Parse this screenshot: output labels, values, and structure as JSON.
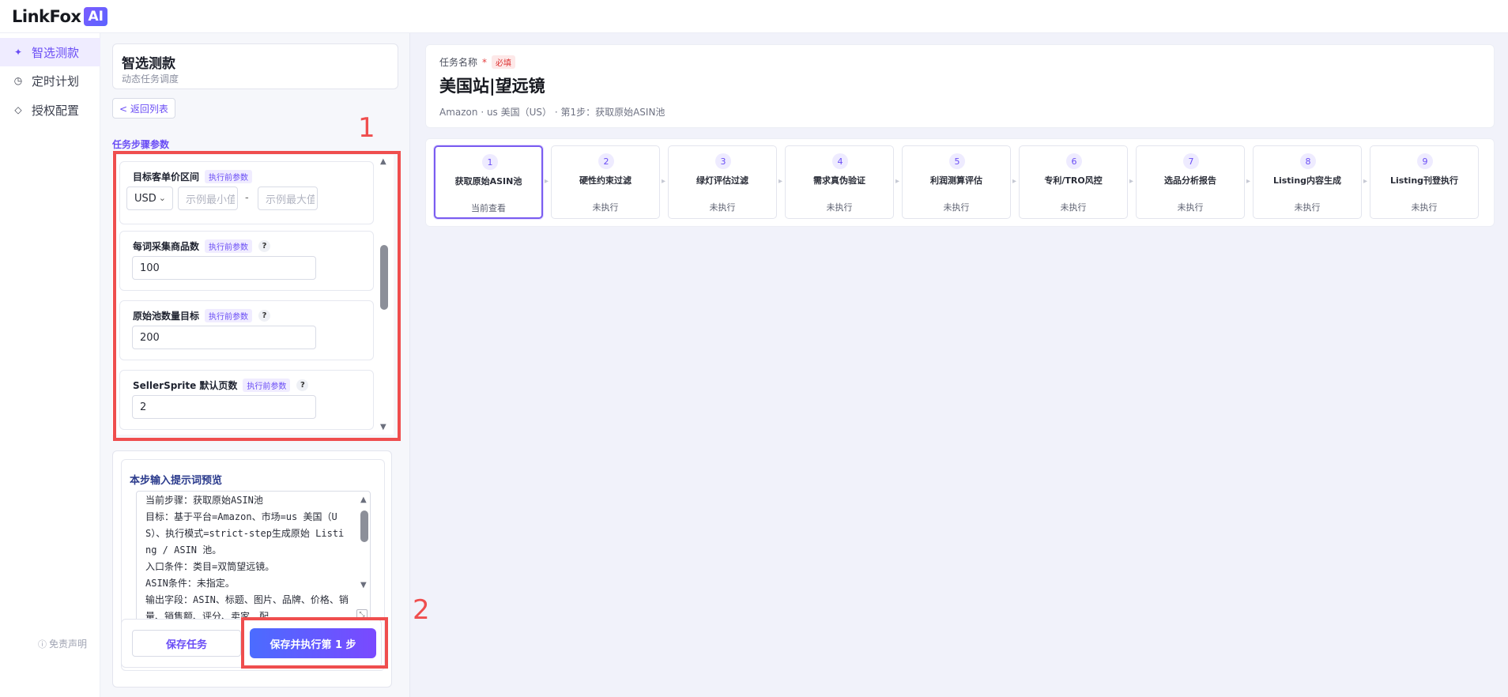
{
  "app": {
    "logo_text": "LinkFox",
    "logo_badge": "AI"
  },
  "nav": {
    "items": [
      {
        "label": "智选测款",
        "icon": "sparkle-icon"
      },
      {
        "label": "定时计划",
        "icon": "clock-icon"
      },
      {
        "label": "授权配置",
        "icon": "diamond-icon"
      }
    ],
    "disclaimer": "免责声明"
  },
  "left": {
    "title": "智选测款",
    "subtitle": "动态任务调度",
    "back_label": "< 返回列表",
    "section_label": "任务步骤参数",
    "params": {
      "price": {
        "title": "目标客单价区间",
        "chip": "执行前参数",
        "currency": "USD",
        "min_placeholder": "示例最小值",
        "max_placeholder": "示例最大值",
        "dash": "-"
      },
      "per_word": {
        "title": "每词采集商品数",
        "chip": "执行前参数",
        "value": "100"
      },
      "pool": {
        "title": "原始池数量目标",
        "chip": "执行前参数",
        "value": "200"
      },
      "pages": {
        "title": "SellerSprite 默认页数",
        "chip": "执行前参数",
        "value": "2"
      }
    },
    "prompt": {
      "title": "本步输入提示词预览",
      "text": "当前步骤：获取原始ASIN池\n目标：基于平台=Amazon、市场=us 美国（US）、执行模式=strict-step生成原始 Listing / ASIN 池。\n入口条件：类目=双筒望远镜。\nASIN条件：未指定。\n输出字段：ASIN、标题、图片、品牌、价格、销量、销售额、评分、卖家、配"
    },
    "save_label": "保存任务",
    "run_label": "保存并执行第 1 步"
  },
  "annotations": {
    "one": "1",
    "two": "2"
  },
  "task": {
    "label": "任务名称",
    "required_star": "*",
    "required_chip": "必填",
    "name": "美国站|望远镜",
    "meta": "Amazon · us 美国（US） · 第1步：获取原始ASIN池"
  },
  "steps": [
    {
      "num": "1",
      "name": "获取原始ASIN池",
      "status": "当前查看"
    },
    {
      "num": "2",
      "name": "硬性约束过滤",
      "status": "未执行"
    },
    {
      "num": "3",
      "name": "绿灯评估过滤",
      "status": "未执行"
    },
    {
      "num": "4",
      "name": "需求真伪验证",
      "status": "未执行"
    },
    {
      "num": "5",
      "name": "利润测算评估",
      "status": "未执行"
    },
    {
      "num": "6",
      "name": "专利/TRO风控",
      "status": "未执行"
    },
    {
      "num": "7",
      "name": "选品分析报告",
      "status": "未执行"
    },
    {
      "num": "8",
      "name": "Listing内容生成",
      "status": "未执行"
    },
    {
      "num": "9",
      "name": "Listing刊登执行",
      "status": "未执行"
    }
  ],
  "colors": {
    "accent": "#6a4df5",
    "annotation": "#ef4e4e"
  }
}
